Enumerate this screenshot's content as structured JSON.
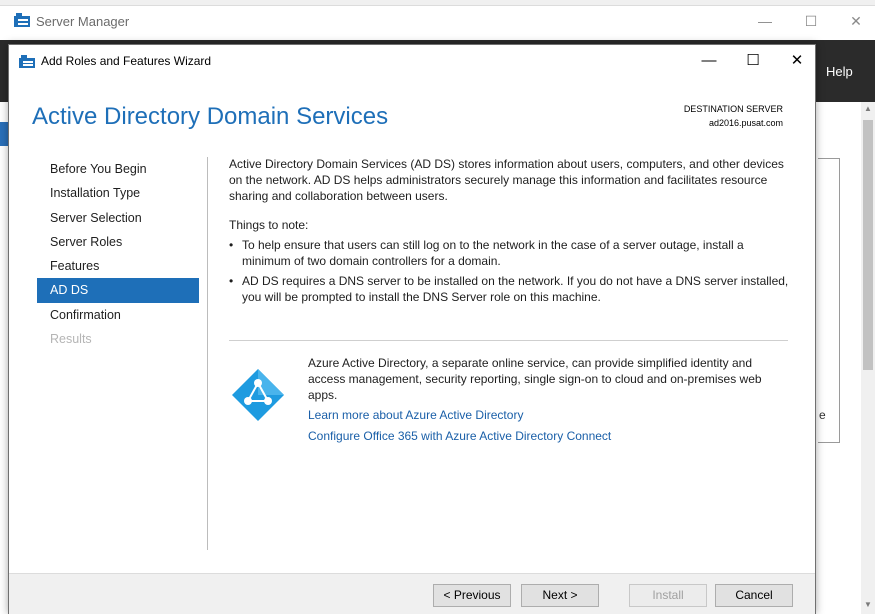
{
  "server_manager": {
    "title": "Server Manager",
    "help_label": "Help",
    "partial_text": "e",
    "controls": {
      "minimize": "—",
      "maximize": "☐",
      "close": "✕"
    }
  },
  "wizard": {
    "title": "Add Roles and Features Wizard",
    "controls": {
      "minimize": "—",
      "maximize": "☐",
      "close": "✕"
    },
    "heading": "Active Directory Domain Services",
    "destination_label": "DESTINATION SERVER",
    "destination_value": "ad2016.pusat.com",
    "nav": [
      {
        "label": "Before You Begin",
        "state": "normal"
      },
      {
        "label": "Installation Type",
        "state": "normal"
      },
      {
        "label": "Server Selection",
        "state": "normal"
      },
      {
        "label": "Server Roles",
        "state": "normal"
      },
      {
        "label": "Features",
        "state": "normal"
      },
      {
        "label": "AD DS",
        "state": "active"
      },
      {
        "label": "Confirmation",
        "state": "normal"
      },
      {
        "label": "Results",
        "state": "disabled"
      }
    ],
    "content": {
      "intro": "Active Directory Domain Services (AD DS) stores information about users, computers, and other devices on the network.  AD DS helps administrators securely manage this information and facilitates resource sharing and collaboration between users.",
      "notes_heading": "Things to note:",
      "bullet_char": "•",
      "notes": [
        "To help ensure that users can still log on to the network in the case of a server outage, install a minimum of two domain controllers for a domain.",
        "AD DS requires a DNS server to be installed on the network.  If you do not have a DNS server installed, you will be prompted to install the DNS Server role on this machine."
      ],
      "azure_text": "Azure Active Directory, a separate online service, can provide simplified identity and access management, security reporting, single sign-on to cloud and on-premises web apps.",
      "links": [
        "Learn more about Azure Active Directory",
        "Configure Office 365 with Azure Active Directory Connect"
      ]
    },
    "buttons": {
      "previous": "< Previous",
      "next": "Next >",
      "install": "Install",
      "cancel": "Cancel"
    }
  },
  "colors": {
    "accent": "#1e6fb8",
    "azure": "#1e9be0",
    "link": "#1a5fa8",
    "dark_header": "#2b2b2b"
  }
}
